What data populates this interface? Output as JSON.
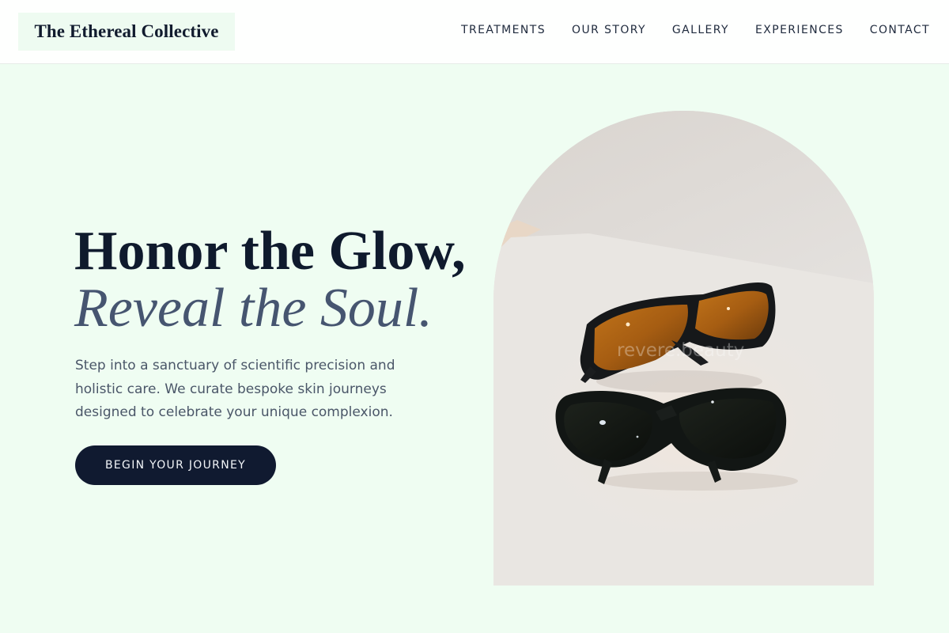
{
  "brand": {
    "name": "The Ethereal Collective"
  },
  "nav": {
    "items": [
      {
        "label": "TREATMENTS"
      },
      {
        "label": "OUR STORY"
      },
      {
        "label": "GALLERY"
      },
      {
        "label": "EXPERIENCES"
      },
      {
        "label": "CONTACT"
      }
    ]
  },
  "hero": {
    "headline_line1": "Honor the Glow,",
    "headline_line2": "Reveal the Soul.",
    "intro": "Step into a sanctuary of scientific precision and holistic care. We curate bespoke skin journeys designed to celebrate your unique complexion.",
    "cta_label": "BEGIN YOUR JOURNEY",
    "image": {
      "subject": "two pairs of protective laser-safety goggles on a white surface",
      "watermark": "revere.beauty"
    }
  },
  "colors": {
    "page_background": "#effdf2",
    "header_background": "#fefffe",
    "brand_background": "#eefbf1",
    "headline_primary": "#0f1a2d",
    "headline_italic": "#465570",
    "body_text": "#4a5668",
    "cta_background": "#101a30",
    "cta_text": "#f2f5f8"
  }
}
